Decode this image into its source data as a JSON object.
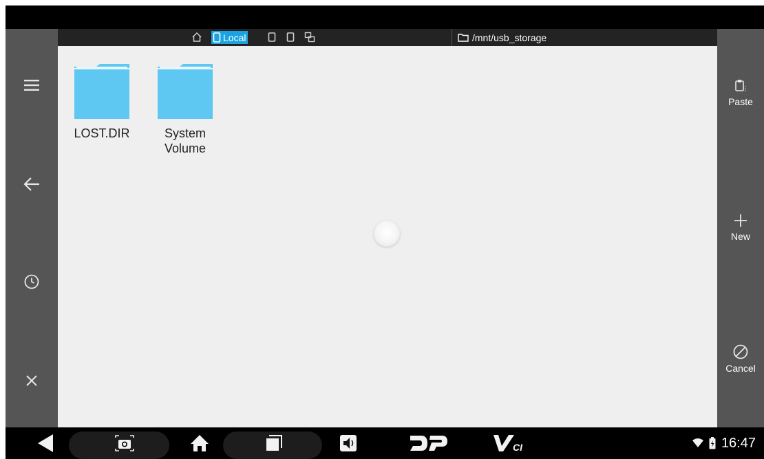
{
  "topbar": {
    "local_tab_label": "Local",
    "current_path": "/mnt/usb_storage"
  },
  "files": [
    {
      "name": "LOST.DIR"
    },
    {
      "name": "System\nVolume"
    }
  ],
  "right_actions": {
    "paste_label": "Paste",
    "new_label": "New",
    "cancel_label": "Cancel"
  },
  "status": {
    "time": "16:47"
  },
  "navbar": {
    "dp_label": "DP",
    "vci_label": "V",
    "vci_sub": "CI"
  },
  "colors": {
    "accent": "#1aa3e0",
    "folder": "#5ec8f2",
    "rail": "#555555",
    "content_bg": "#efefef"
  }
}
